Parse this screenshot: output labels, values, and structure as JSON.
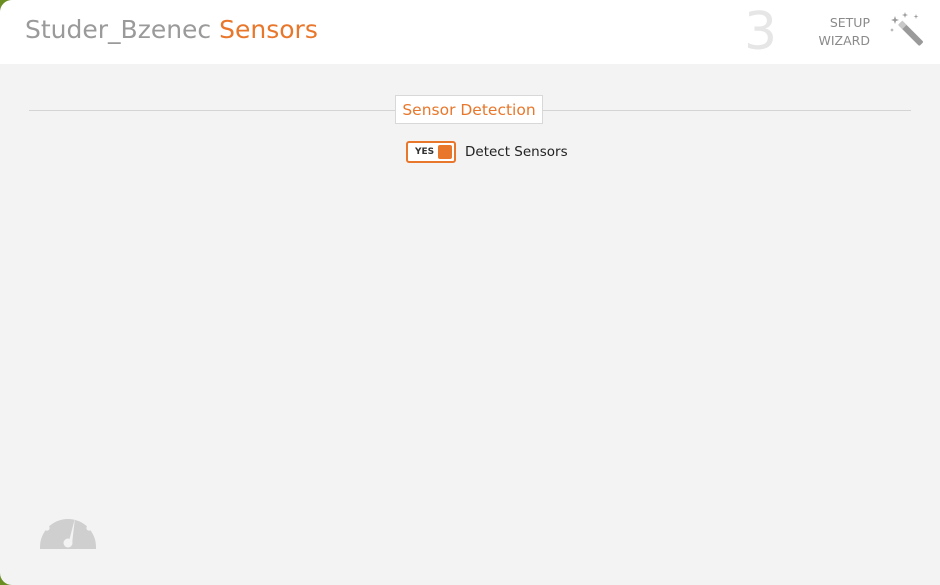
{
  "header": {
    "title_prefix": "Studer_Bzenec",
    "title_highlight": "Sensors",
    "step_number": "3",
    "setup_line1": "SETUP",
    "setup_line2": "WIZARD",
    "wizard_icon": "magic-wand-icon"
  },
  "section": {
    "title": "Sensor Detection"
  },
  "toggle": {
    "state_label": "YES",
    "label": "Detect Sensors",
    "on": true
  },
  "footer": {
    "icon": "dashboard-gauge-icon"
  },
  "colors": {
    "accent": "#e8772b",
    "title_gray": "#9a9a9a",
    "background": "#f3f3f3"
  }
}
